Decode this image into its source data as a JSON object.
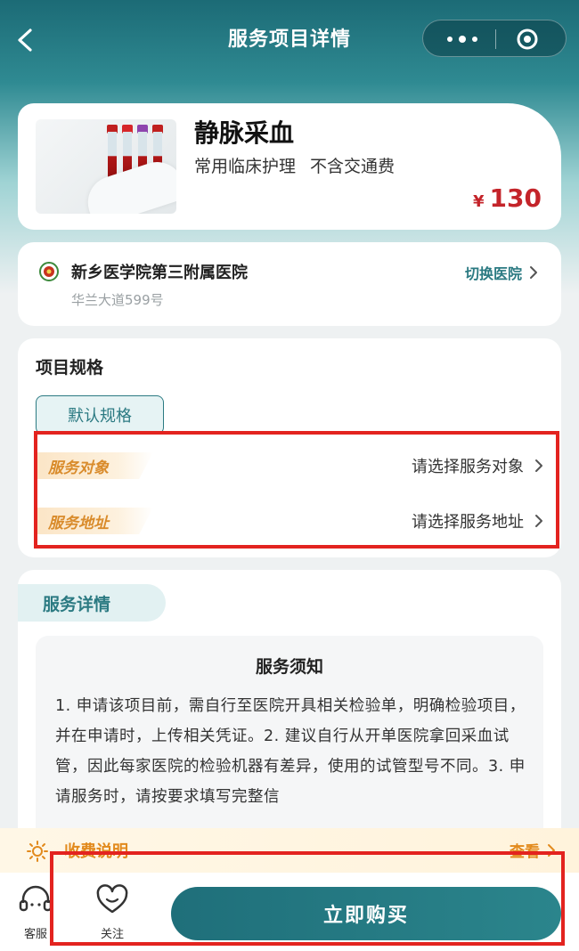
{
  "nav": {
    "title": "服务项目详情"
  },
  "product": {
    "name": "静脉采血",
    "tags": [
      "常用临床护理",
      "不含交通费"
    ],
    "currency": "¥",
    "price": "130"
  },
  "hospital": {
    "name": "新乡医学院第三附属医院",
    "address": "华兰大道599号",
    "switch_label": "切换医院"
  },
  "spec": {
    "title": "项目规格",
    "chip": "默认规格",
    "rows": [
      {
        "label": "服务对象",
        "value": "请选择服务对象"
      },
      {
        "label": "服务地址",
        "value": "请选择服务地址"
      }
    ]
  },
  "detail": {
    "tab": "服务详情",
    "notice_title": "服务须知",
    "notice_body": "1. 申请该项目前，需自行至医院开具相关检验单，明确检验项目，并在申请时，上传相关凭证。2. 建议自行从开单医院拿回采血试管，因此每家医院的检验机器有差异，使用的试管型号不同。3. 申请服务时，请按要求填写完整信"
  },
  "fee": {
    "label": "收费说明",
    "view": "查看"
  },
  "bottom": {
    "service_label": "客服",
    "follow_label": "关注",
    "buy_label": "立即购买"
  },
  "colors": {
    "brand": "#2b7a82",
    "price": "#c4242a",
    "accent_orange": "#e28a1d",
    "highlight_red": "#e3231f"
  }
}
